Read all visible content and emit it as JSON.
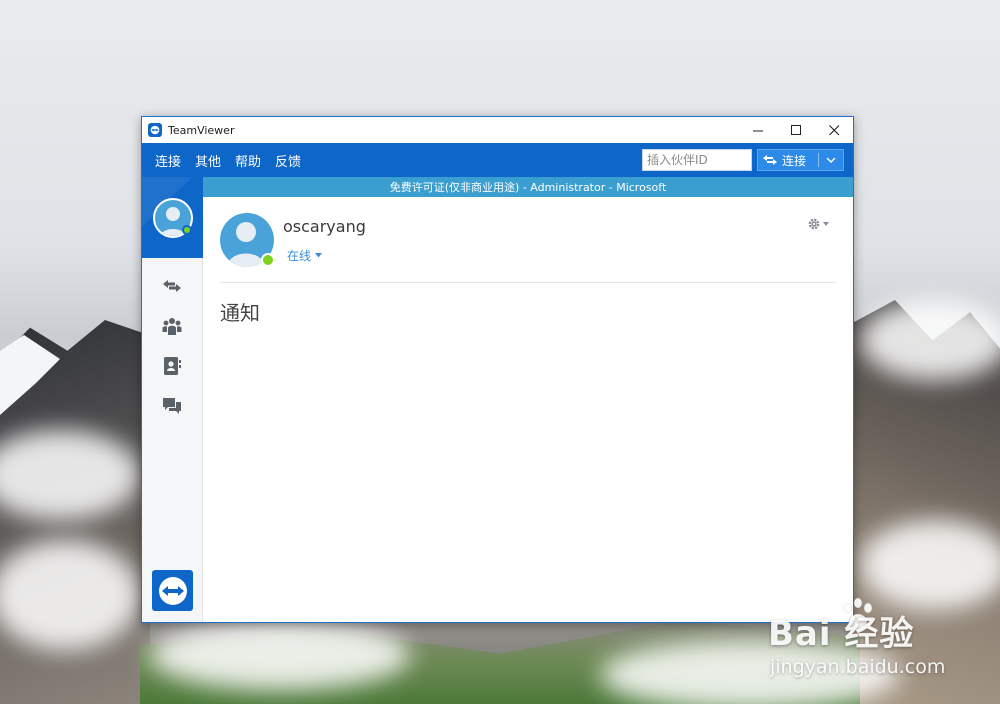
{
  "window": {
    "title": "TeamViewer",
    "controls": {
      "minimize": "—",
      "maximize": "☐",
      "close": "✕"
    }
  },
  "menu": {
    "items": [
      "连接",
      "其他",
      "帮助",
      "反馈"
    ]
  },
  "toolbar": {
    "partner_id_placeholder": "插入伙伴ID",
    "connect_label": "连接"
  },
  "license_bar": {
    "text": "免费许可证(仅非商业用途) - Administrator - Microsoft"
  },
  "profile": {
    "username": "oscaryang",
    "status": "在线"
  },
  "main": {
    "section_title": "通知"
  },
  "sidebar": {
    "icons": [
      "remote-control-icon",
      "meeting-icon",
      "contacts-icon",
      "chat-icon"
    ]
  },
  "watermark": {
    "brand": "Bai  经验",
    "url": "jingyan.baidu.com"
  },
  "colors": {
    "brand_blue": "#0e66c9",
    "license_bar": "#3a9ed0",
    "online_green": "#7ed321",
    "status_link": "#3a8fd6"
  }
}
